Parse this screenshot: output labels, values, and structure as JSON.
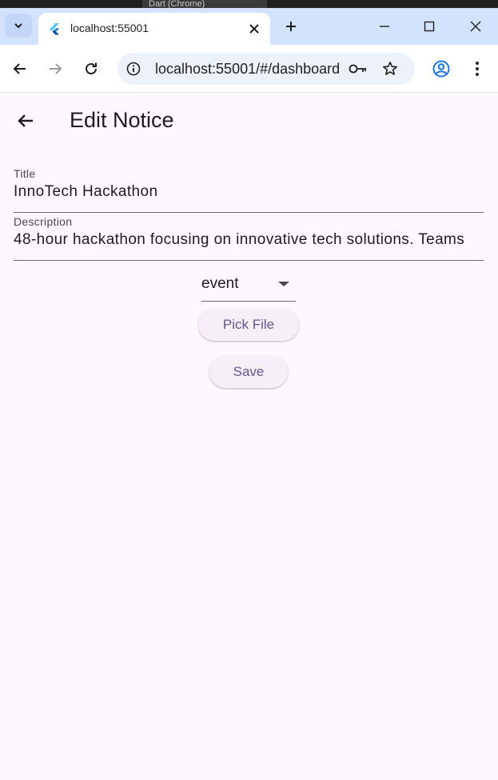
{
  "browser": {
    "background_tab_title": "Dart (Chrome)",
    "tab": {
      "title": "localhost:55001",
      "favicon": "flutter-icon"
    },
    "omnibox": {
      "url": "localhost:55001/#/dashboard"
    },
    "icons": {
      "tab_search": "chevron-down-icon",
      "close_tab": "close-icon",
      "new_tab": "plus-icon",
      "minimize": "minimize-icon",
      "maximize": "maximize-icon",
      "close_window": "close-icon",
      "back": "arrow-left-icon",
      "forward": "arrow-right-icon",
      "reload": "reload-icon",
      "site_info": "info-icon",
      "password": "key-icon",
      "bookmark": "star-icon",
      "profile": "account-icon",
      "menu": "more-vertical-icon"
    }
  },
  "app": {
    "title": "Edit Notice",
    "form": {
      "title_label": "Title",
      "title_value": "InnoTech Hackathon",
      "description_label": "Description",
      "description_value": "48-hour hackathon focusing on innovative tech solutions. Teams",
      "type_value": "event",
      "pick_file_label": "Pick File",
      "save_label": "Save"
    }
  },
  "colors": {
    "page_background": "#fdf7fe",
    "button_text": "#65558f",
    "button_background": "#f6eff8",
    "tabbar_background": "#d3e3fd",
    "omnibox_background": "#edf2fa"
  }
}
